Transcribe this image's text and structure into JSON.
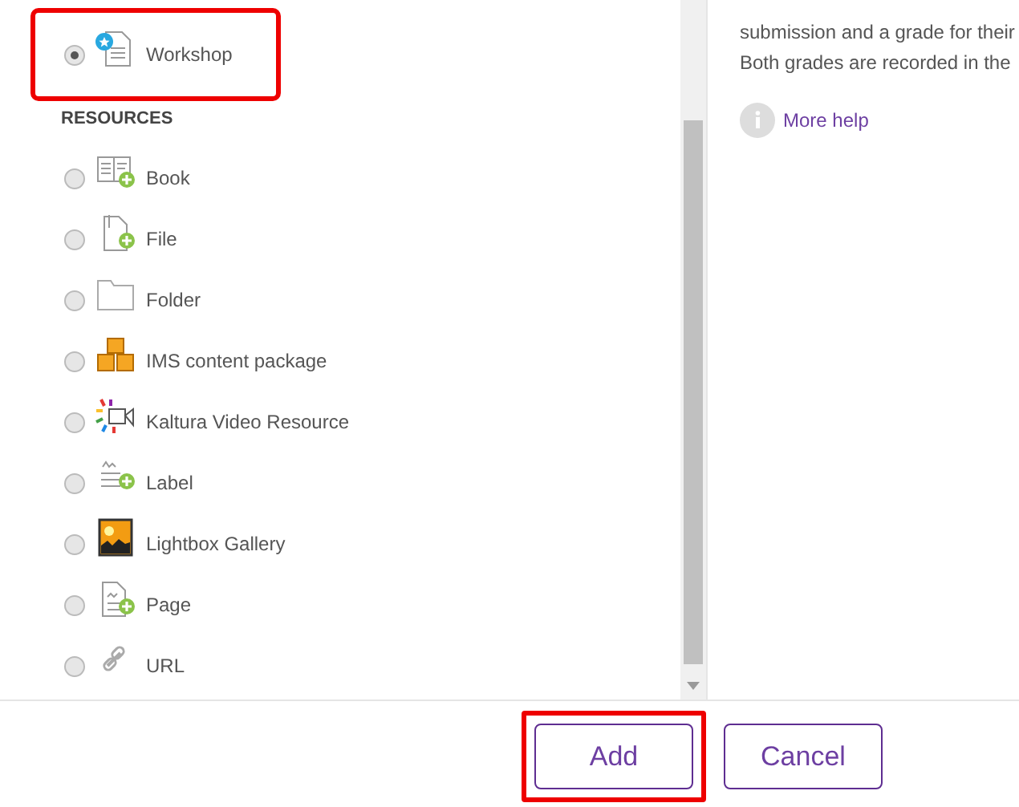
{
  "activities_tail": [
    {
      "label": "Workshop",
      "kind": "workshop",
      "selected": true,
      "highlighted": true
    }
  ],
  "resources": {
    "heading": "RESOURCES",
    "items": [
      {
        "label": "Book",
        "kind": "book",
        "selected": false
      },
      {
        "label": "File",
        "kind": "file",
        "selected": false
      },
      {
        "label": "Folder",
        "kind": "folder",
        "selected": false
      },
      {
        "label": "IMS content package",
        "kind": "ims",
        "selected": false
      },
      {
        "label": "Kaltura Video Resource",
        "kind": "kaltura",
        "selected": false
      },
      {
        "label": "Label",
        "kind": "label",
        "selected": false
      },
      {
        "label": "Lightbox Gallery",
        "kind": "lightbox",
        "selected": false
      },
      {
        "label": "Page",
        "kind": "page",
        "selected": false
      },
      {
        "label": "URL",
        "kind": "url",
        "selected": false
      }
    ]
  },
  "description": {
    "lines": [
      "submission and a grade for their",
      "Both grades are recorded in the"
    ],
    "help_link": "More help"
  },
  "buttons": [
    {
      "label": "Add",
      "highlighted": true
    },
    {
      "label": "Cancel",
      "highlighted": false
    }
  ]
}
